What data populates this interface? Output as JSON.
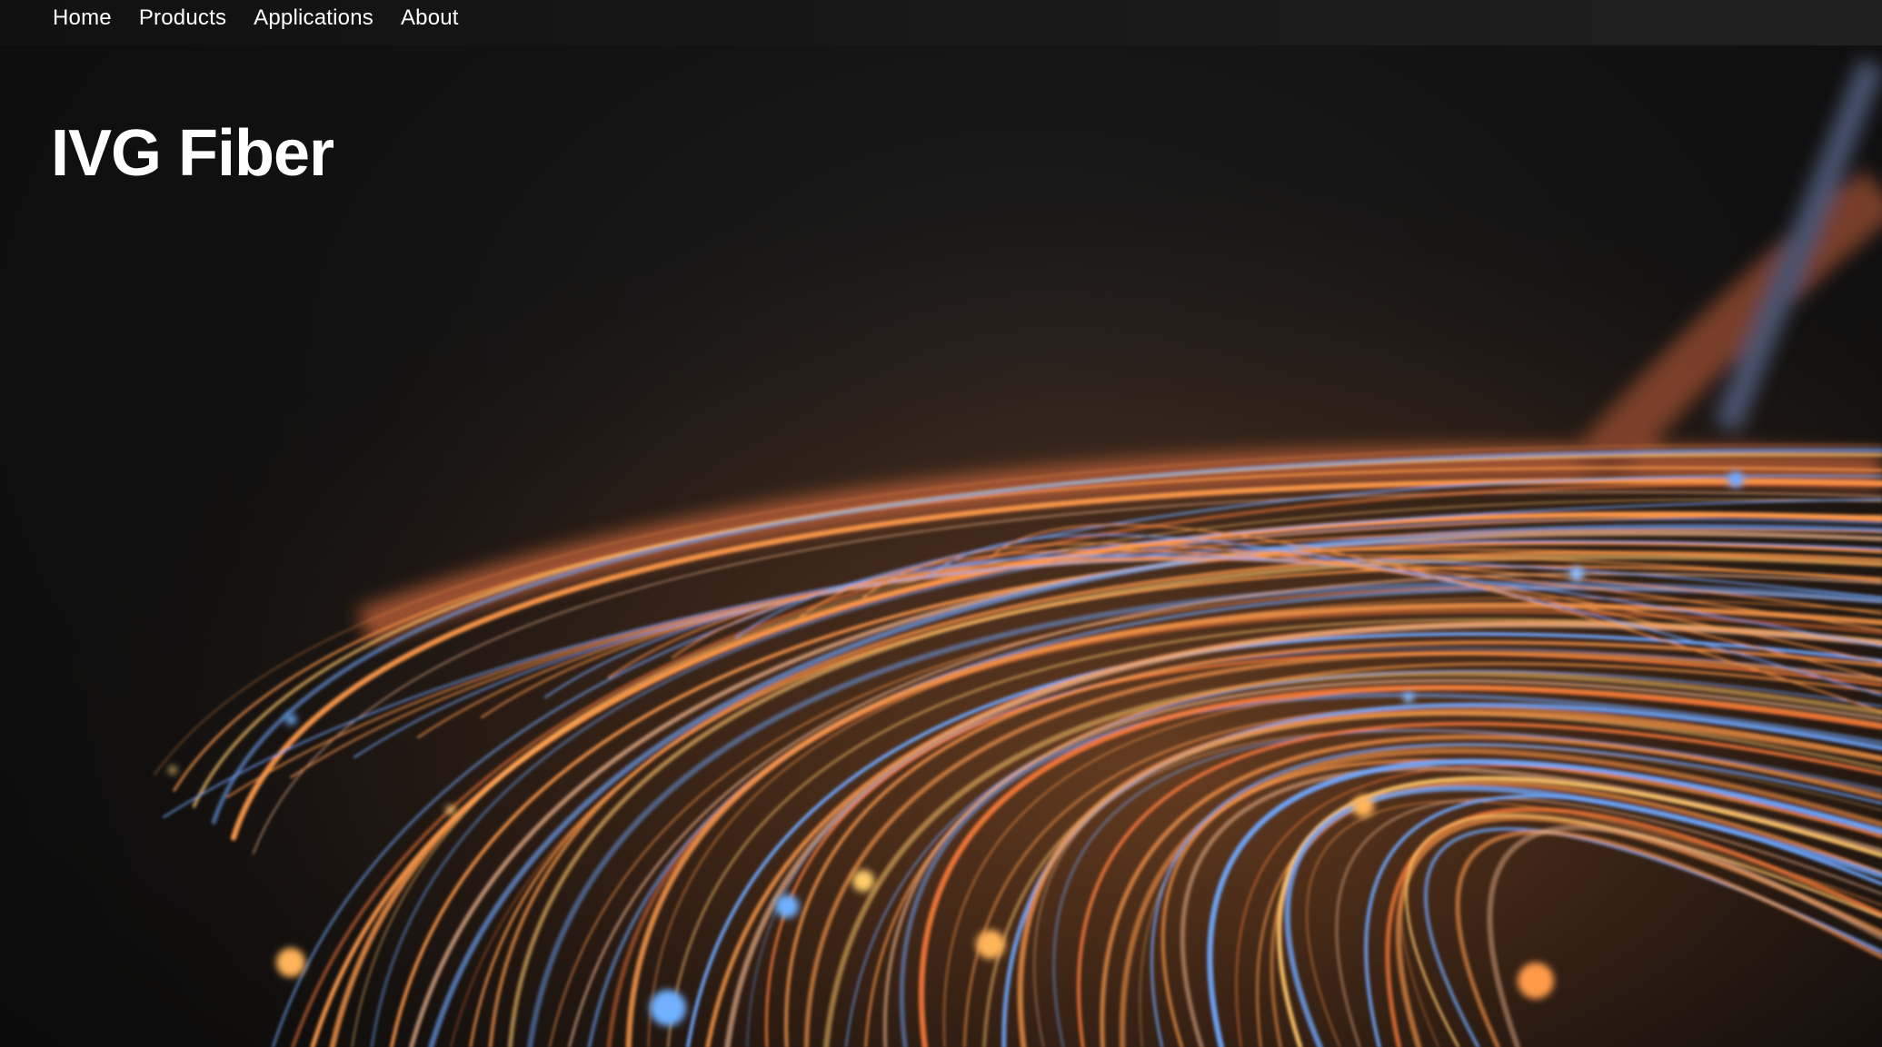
{
  "nav": {
    "items": [
      {
        "label": "Home"
      },
      {
        "label": "Products"
      },
      {
        "label": "Applications"
      },
      {
        "label": "About"
      }
    ]
  },
  "hero": {
    "title": "IVG Fiber",
    "background_image": "fiber-optic-light-strands",
    "colors": {
      "orange": "#ff9a4a",
      "amber": "#ffc66a",
      "blue": "#6fa8ff",
      "background": "#121212"
    }
  }
}
